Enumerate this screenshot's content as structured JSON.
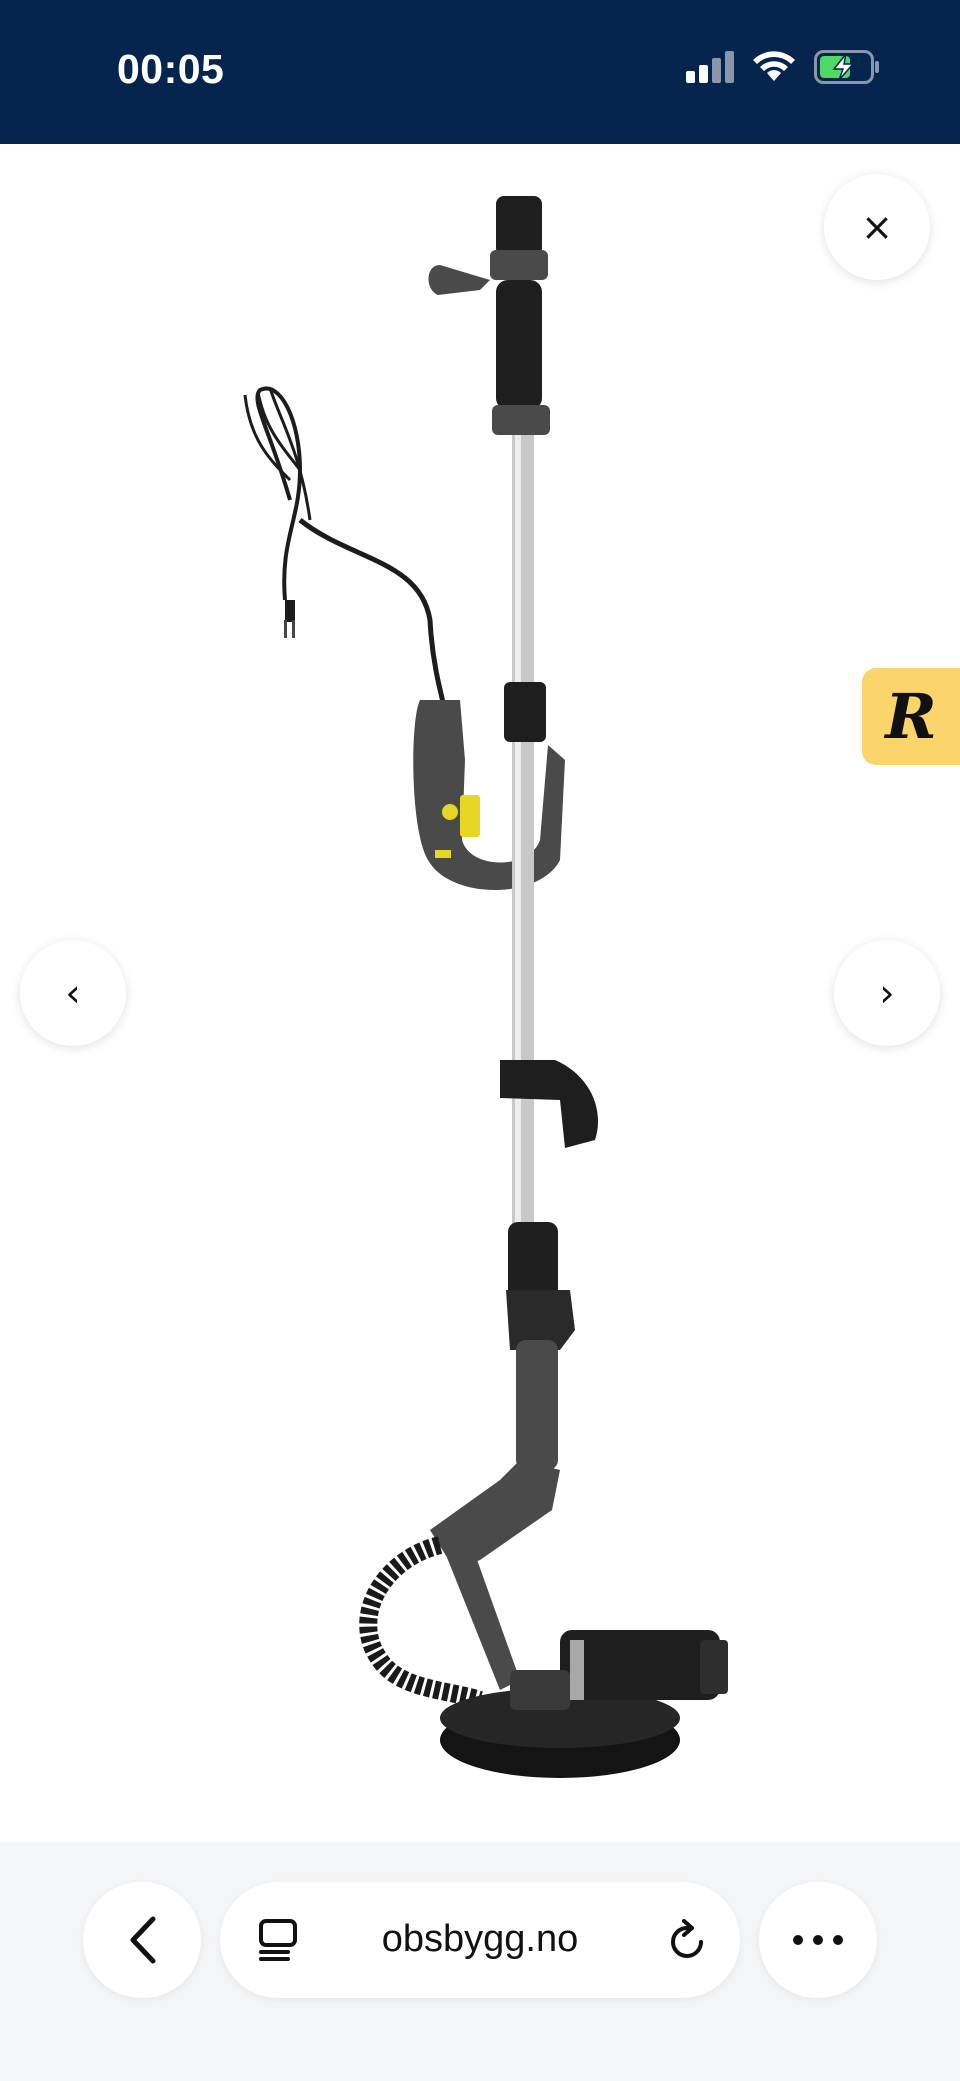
{
  "status_bar": {
    "time": "00:05",
    "background": "#05254f",
    "icons": [
      "signal-icon",
      "wifi-icon",
      "battery-charging-icon"
    ],
    "battery_accent": "#4cd964"
  },
  "gallery": {
    "image_alt": "Product image: long-reach drywall sander",
    "close_label": "×",
    "prev_label": "‹",
    "next_label": "›"
  },
  "badge": {
    "text": "R",
    "background": "#fbd56b"
  },
  "browser": {
    "url": "obsbygg.no",
    "icons": [
      "back-icon",
      "tabs-icon",
      "reload-icon",
      "more-icon"
    ]
  }
}
